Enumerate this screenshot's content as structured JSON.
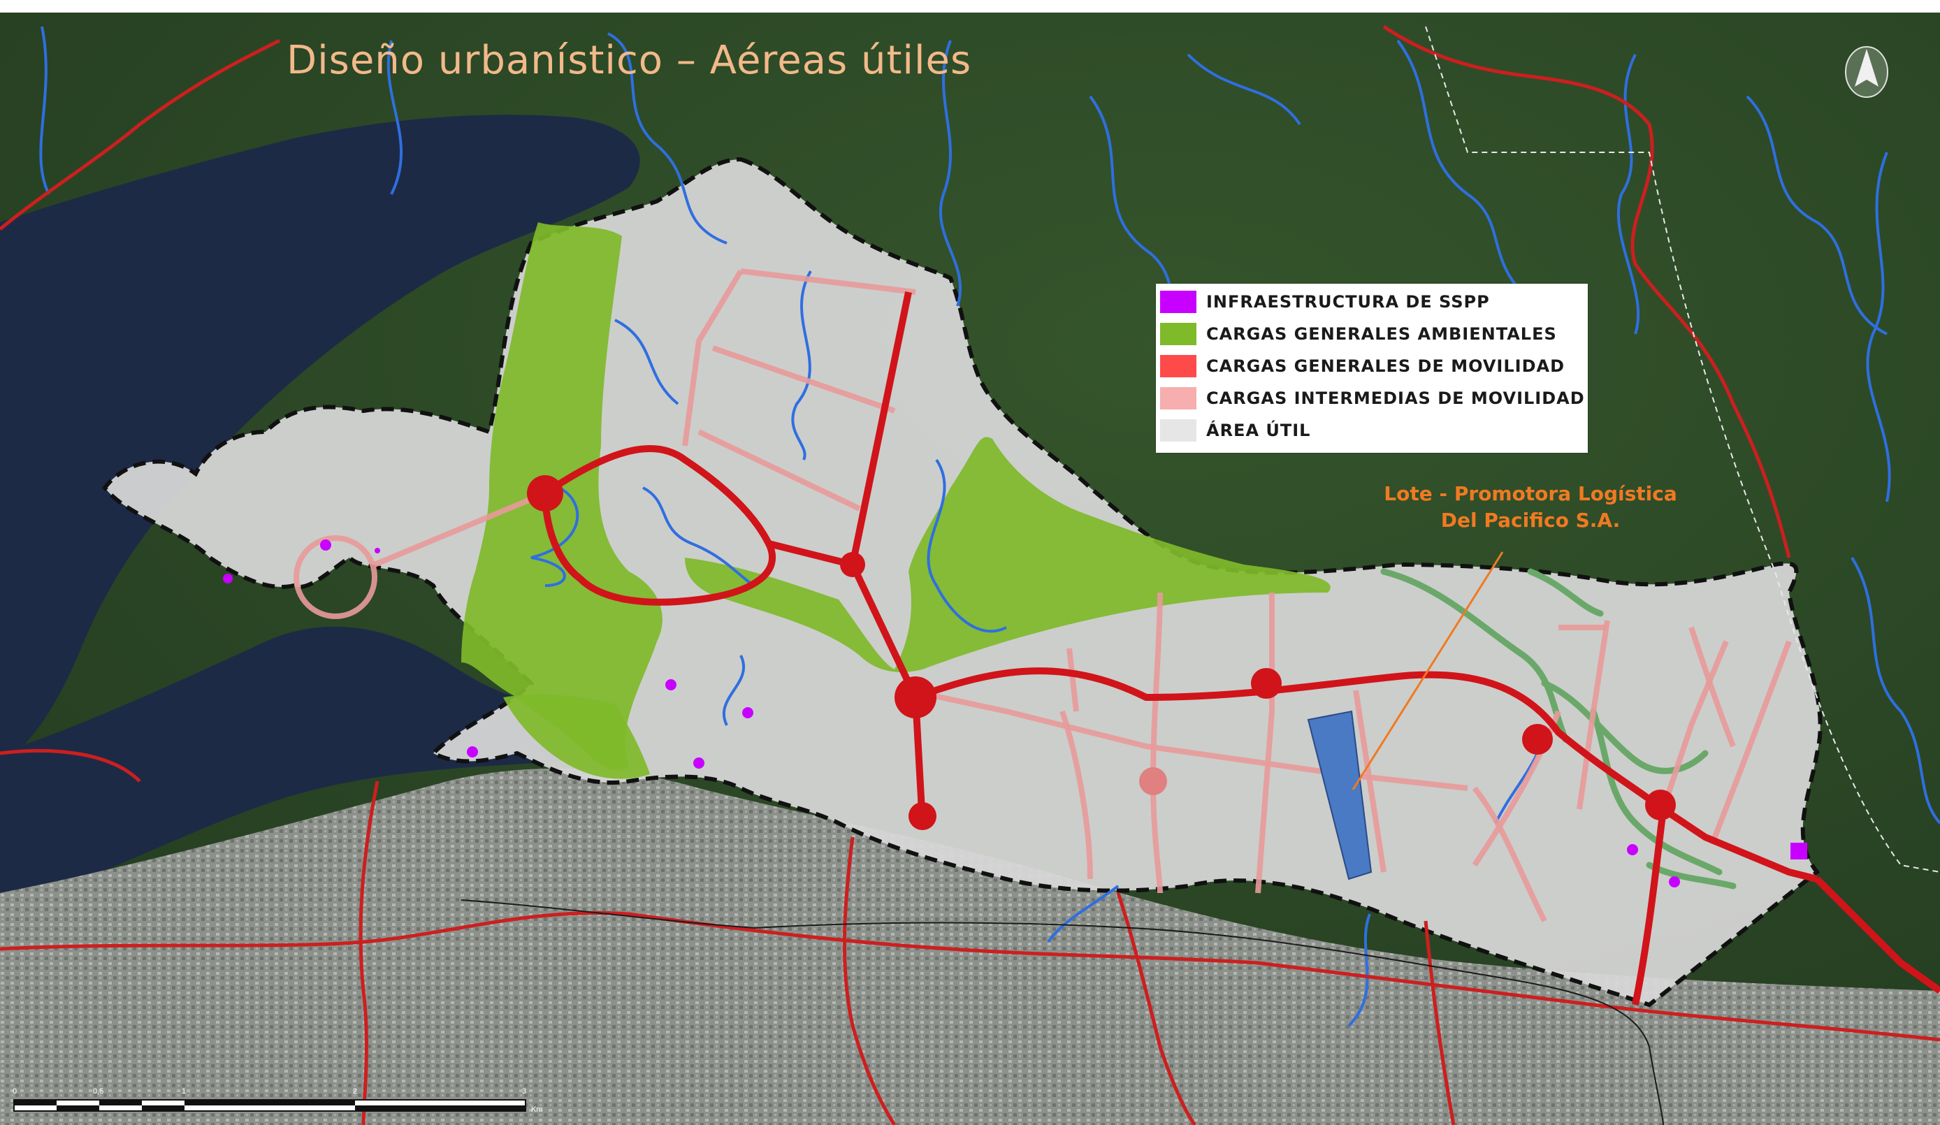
{
  "title": "Diseño urbanístico – Aéreas útiles",
  "legend": [
    {
      "label": "INFRAESTRUCTURA DE SSPP",
      "color": "#c800ff"
    },
    {
      "label": "CARGAS GENERALES AMBIENTALES",
      "color": "#7fba2a"
    },
    {
      "label": "CARGAS GENERALES DE MOVILIDAD",
      "color": "#ff4a4a"
    },
    {
      "label": "CARGAS INTERMEDIAS DE MOVILIDAD",
      "color": "#f6aeae"
    },
    {
      "label": "ÁREA ÚTIL",
      "color": "#e6e6e6"
    }
  ],
  "lot_label": {
    "line1": "Lote - Promotora Logística",
    "line2": "Del Pacifico S.A."
  },
  "scale_bar": {
    "ticks": [
      "0",
      "0,5",
      "1",
      "2",
      "3"
    ],
    "unit": "Km"
  },
  "colors": {
    "water": "#1d2a46",
    "forest": "#2c4a26",
    "urban": "#8a8f8a",
    "useful_area": "#d8d8d8",
    "environmental": "#7fba2a",
    "main_road": "#d0141a",
    "secondary_road": "#e89a9a",
    "river": "#2f6fe0",
    "lot": "#4a7ac4",
    "lot_label": "#f07a22"
  },
  "icons": [
    "north-arrow-icon"
  ]
}
